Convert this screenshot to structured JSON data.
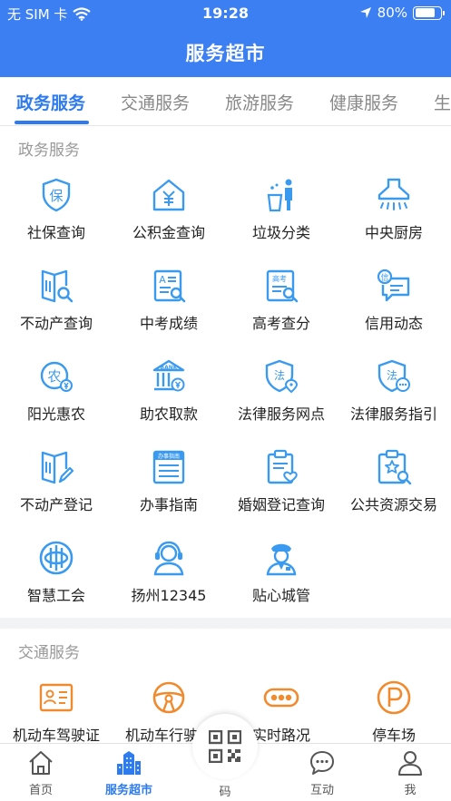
{
  "status_bar": {
    "carrier": "无 SIM 卡",
    "time": "19:28",
    "battery": "80%",
    "battery_level": 0.8
  },
  "header": {
    "title": "服务超市"
  },
  "tabs": [
    {
      "label": "政务服务",
      "active": true
    },
    {
      "label": "交通服务"
    },
    {
      "label": "旅游服务"
    },
    {
      "label": "健康服务"
    },
    {
      "label": "生"
    }
  ],
  "sections": {
    "gov": {
      "title": "政务服务",
      "items": [
        {
          "label": "社保查询",
          "icon": "shield-bao-icon"
        },
        {
          "label": "公积金查询",
          "icon": "house-yuan-icon"
        },
        {
          "label": "垃圾分类",
          "icon": "trash-person-icon"
        },
        {
          "label": "中央厨房",
          "icon": "range-hood-icon"
        },
        {
          "label": "不动产查询",
          "icon": "book-search-icon"
        },
        {
          "label": "中考成绩",
          "icon": "doc-a-search-icon"
        },
        {
          "label": "高考查分",
          "icon": "doc-gaokao-search-icon"
        },
        {
          "label": "信用动态",
          "icon": "credit-message-icon"
        },
        {
          "label": "阳光惠农",
          "icon": "farm-coin-icon"
        },
        {
          "label": "助农取款",
          "icon": "bank-icon"
        },
        {
          "label": "法律服务网点",
          "icon": "law-shield-location-icon"
        },
        {
          "label": "法律服务指引",
          "icon": "law-shield-chat-icon"
        },
        {
          "label": "不动产登记",
          "icon": "book-edit-icon"
        },
        {
          "label": "办事指南",
          "icon": "guide-book-icon"
        },
        {
          "label": "婚姻登记查询",
          "icon": "clipboard-heart-icon"
        },
        {
          "label": "公共资源交易",
          "icon": "clipboard-star-icon"
        },
        {
          "label": "智慧工会",
          "icon": "union-logo-icon"
        },
        {
          "label": "扬州12345",
          "icon": "headset-operator-icon"
        },
        {
          "label": "贴心城管",
          "icon": "officer-icon"
        }
      ],
      "guide_tag": "办事指南",
      "gaokao_tag": "高考",
      "law_char": "法",
      "bao_char": "保",
      "nong_char": "农",
      "xin_char": "信",
      "bank_text": "BANK"
    },
    "traffic": {
      "title": "交通服务",
      "items": [
        {
          "label": "机动车驾驶证",
          "icon": "license-card-icon"
        },
        {
          "label": "机动车行驶证",
          "icon": "steering-wheel-icon"
        },
        {
          "label": "实时路况",
          "icon": "traffic-dots-icon"
        },
        {
          "label": "停车场",
          "icon": "parking-icon"
        }
      ]
    }
  },
  "tabbar": {
    "items": [
      {
        "label": "首页",
        "icon": "home-icon"
      },
      {
        "label": "服务超市",
        "icon": "city-buildings-icon",
        "active": true
      },
      {
        "label": "码",
        "icon": "qr-code-icon"
      },
      {
        "label": "互动",
        "icon": "chat-bubble-icon"
      },
      {
        "label": "我",
        "icon": "person-icon"
      }
    ]
  },
  "colors": {
    "primary": "#3b7ff2",
    "tab_active": "#2e7bf0",
    "icon_blue": "#3a9af0",
    "icon_orange": "#f08a2c"
  }
}
